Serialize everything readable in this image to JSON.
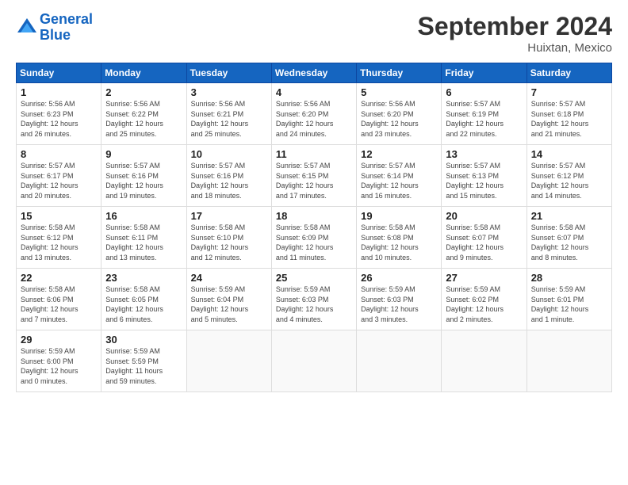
{
  "header": {
    "logo_line1": "General",
    "logo_line2": "Blue",
    "month_title": "September 2024",
    "location": "Huixtan, Mexico"
  },
  "days_of_week": [
    "Sunday",
    "Monday",
    "Tuesday",
    "Wednesday",
    "Thursday",
    "Friday",
    "Saturday"
  ],
  "weeks": [
    [
      {
        "num": "1",
        "info": "Sunrise: 5:56 AM\nSunset: 6:23 PM\nDaylight: 12 hours\nand 26 minutes."
      },
      {
        "num": "2",
        "info": "Sunrise: 5:56 AM\nSunset: 6:22 PM\nDaylight: 12 hours\nand 25 minutes."
      },
      {
        "num": "3",
        "info": "Sunrise: 5:56 AM\nSunset: 6:21 PM\nDaylight: 12 hours\nand 25 minutes."
      },
      {
        "num": "4",
        "info": "Sunrise: 5:56 AM\nSunset: 6:20 PM\nDaylight: 12 hours\nand 24 minutes."
      },
      {
        "num": "5",
        "info": "Sunrise: 5:56 AM\nSunset: 6:20 PM\nDaylight: 12 hours\nand 23 minutes."
      },
      {
        "num": "6",
        "info": "Sunrise: 5:57 AM\nSunset: 6:19 PM\nDaylight: 12 hours\nand 22 minutes."
      },
      {
        "num": "7",
        "info": "Sunrise: 5:57 AM\nSunset: 6:18 PM\nDaylight: 12 hours\nand 21 minutes."
      }
    ],
    [
      {
        "num": "8",
        "info": "Sunrise: 5:57 AM\nSunset: 6:17 PM\nDaylight: 12 hours\nand 20 minutes."
      },
      {
        "num": "9",
        "info": "Sunrise: 5:57 AM\nSunset: 6:16 PM\nDaylight: 12 hours\nand 19 minutes."
      },
      {
        "num": "10",
        "info": "Sunrise: 5:57 AM\nSunset: 6:16 PM\nDaylight: 12 hours\nand 18 minutes."
      },
      {
        "num": "11",
        "info": "Sunrise: 5:57 AM\nSunset: 6:15 PM\nDaylight: 12 hours\nand 17 minutes."
      },
      {
        "num": "12",
        "info": "Sunrise: 5:57 AM\nSunset: 6:14 PM\nDaylight: 12 hours\nand 16 minutes."
      },
      {
        "num": "13",
        "info": "Sunrise: 5:57 AM\nSunset: 6:13 PM\nDaylight: 12 hours\nand 15 minutes."
      },
      {
        "num": "14",
        "info": "Sunrise: 5:57 AM\nSunset: 6:12 PM\nDaylight: 12 hours\nand 14 minutes."
      }
    ],
    [
      {
        "num": "15",
        "info": "Sunrise: 5:58 AM\nSunset: 6:12 PM\nDaylight: 12 hours\nand 13 minutes."
      },
      {
        "num": "16",
        "info": "Sunrise: 5:58 AM\nSunset: 6:11 PM\nDaylight: 12 hours\nand 13 minutes."
      },
      {
        "num": "17",
        "info": "Sunrise: 5:58 AM\nSunset: 6:10 PM\nDaylight: 12 hours\nand 12 minutes."
      },
      {
        "num": "18",
        "info": "Sunrise: 5:58 AM\nSunset: 6:09 PM\nDaylight: 12 hours\nand 11 minutes."
      },
      {
        "num": "19",
        "info": "Sunrise: 5:58 AM\nSunset: 6:08 PM\nDaylight: 12 hours\nand 10 minutes."
      },
      {
        "num": "20",
        "info": "Sunrise: 5:58 AM\nSunset: 6:07 PM\nDaylight: 12 hours\nand 9 minutes."
      },
      {
        "num": "21",
        "info": "Sunrise: 5:58 AM\nSunset: 6:07 PM\nDaylight: 12 hours\nand 8 minutes."
      }
    ],
    [
      {
        "num": "22",
        "info": "Sunrise: 5:58 AM\nSunset: 6:06 PM\nDaylight: 12 hours\nand 7 minutes."
      },
      {
        "num": "23",
        "info": "Sunrise: 5:58 AM\nSunset: 6:05 PM\nDaylight: 12 hours\nand 6 minutes."
      },
      {
        "num": "24",
        "info": "Sunrise: 5:59 AM\nSunset: 6:04 PM\nDaylight: 12 hours\nand 5 minutes."
      },
      {
        "num": "25",
        "info": "Sunrise: 5:59 AM\nSunset: 6:03 PM\nDaylight: 12 hours\nand 4 minutes."
      },
      {
        "num": "26",
        "info": "Sunrise: 5:59 AM\nSunset: 6:03 PM\nDaylight: 12 hours\nand 3 minutes."
      },
      {
        "num": "27",
        "info": "Sunrise: 5:59 AM\nSunset: 6:02 PM\nDaylight: 12 hours\nand 2 minutes."
      },
      {
        "num": "28",
        "info": "Sunrise: 5:59 AM\nSunset: 6:01 PM\nDaylight: 12 hours\nand 1 minute."
      }
    ],
    [
      {
        "num": "29",
        "info": "Sunrise: 5:59 AM\nSunset: 6:00 PM\nDaylight: 12 hours\nand 0 minutes."
      },
      {
        "num": "30",
        "info": "Sunrise: 5:59 AM\nSunset: 5:59 PM\nDaylight: 11 hours\nand 59 minutes."
      },
      null,
      null,
      null,
      null,
      null
    ]
  ]
}
